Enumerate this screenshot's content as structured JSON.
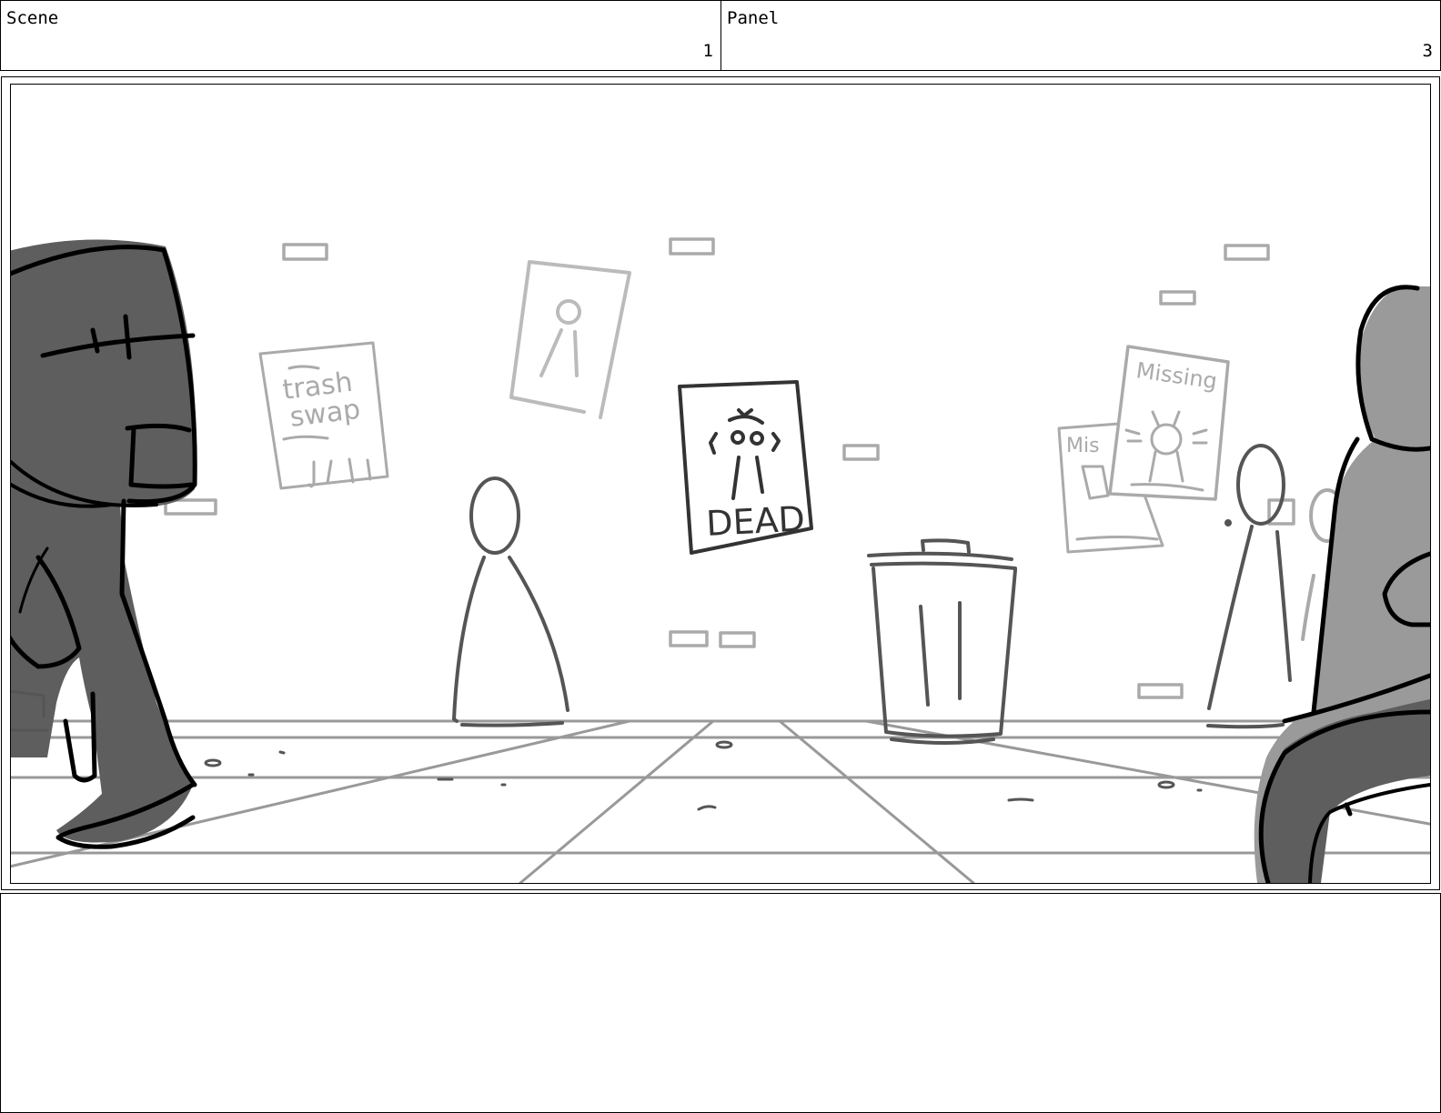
{
  "header": {
    "scene_label": "Scene",
    "scene_number": "1",
    "panel_label": "Panel",
    "panel_number": "3"
  },
  "drawing": {
    "posters": {
      "trash_swap_line1": "trash",
      "trash_swap_line2": "swap",
      "dead_poster": "DEAD",
      "missing_front": "Missing",
      "missing_back": "Mis"
    }
  },
  "notes": {
    "text": ""
  },
  "colors": {
    "border": "#000000",
    "sketch_dark": "#555555",
    "sketch_mid": "#999999",
    "sketch_light": "#bbbbbb",
    "shadow_fill": "#5e5e5e",
    "shadow_fill_light": "#9a9a9a"
  }
}
